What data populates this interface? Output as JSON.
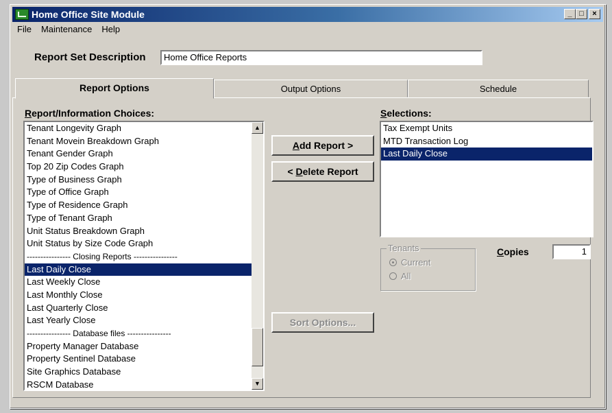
{
  "window": {
    "title": "Home Office Site Module",
    "controls": {
      "minimize": "_",
      "maximize": "□",
      "close": "×"
    }
  },
  "menu": [
    "File",
    "Maintenance",
    "Help"
  ],
  "report_set": {
    "label": "Report Set Description",
    "value": "Home Office Reports"
  },
  "tabs": [
    {
      "label": "Report Options",
      "active": true
    },
    {
      "label": "Output Options",
      "active": false
    },
    {
      "label": "Schedule",
      "active": false
    }
  ],
  "choices": {
    "label_first": "R",
    "label_rest": "eport/Information Choices:",
    "items": [
      "Tenant Longevity Graph",
      "Tenant Movein Breakdown Graph",
      "Tenant Gender Graph",
      "Top 20 Zip Codes Graph",
      "Type of Business Graph",
      "Type of Office Graph",
      "Type of Residence Graph",
      "Type of Tenant Graph",
      "Unit Status Breakdown Graph",
      "Unit Status by Size Code Graph",
      "---------------- Closing Reports ----------------",
      "Last Daily Close",
      "Last Weekly Close",
      "Last Monthly Close",
      "Last Quarterly Close",
      "Last Yearly Close",
      "---------------- Database files ----------------",
      "Property Manager Database",
      "Property Sentinel Database",
      "Site Graphics Database",
      "RSCM Database"
    ],
    "selected_index": 11
  },
  "selections": {
    "label_first": "S",
    "label_rest": "elections:",
    "items": [
      "Tax Exempt Units",
      "MTD Transaction Log",
      "Last Daily Close"
    ],
    "selected_index": 2
  },
  "buttons": {
    "add": {
      "prefix": "",
      "mnemonic": "A",
      "rest": "dd Report >"
    },
    "delete": {
      "prefix": "< ",
      "mnemonic": "D",
      "rest": "elete Report"
    },
    "sort": "Sort Options..."
  },
  "tenants": {
    "title": "Tenants",
    "options": [
      {
        "label": "Current",
        "checked": true
      },
      {
        "label": "All",
        "checked": false
      }
    ]
  },
  "copies": {
    "label_first": "C",
    "label_rest": "opies",
    "value": "1"
  }
}
